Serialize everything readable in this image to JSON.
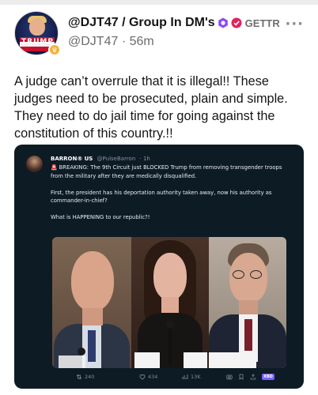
{
  "post": {
    "display_name": "@DJT47 / Group In DM's",
    "platform_label": "GETTR",
    "handle": "@DJT47",
    "separator": " · ",
    "time_ago": "56m",
    "text": "A judge can’t overrule that it is illegal!! These judges need to be prosecuted, plain and simple. They need to do jail time for going against the constitution of this country.!!",
    "more_label": "···",
    "avatar_text": "TRUMP"
  },
  "embed": {
    "author": "BARRON®",
    "flag": "US",
    "handle": "@PulseBarron",
    "time": "· 1h",
    "line1_icon": "🚨",
    "line1": "BREAKING: The 9th Circuit just BLOCKED Trump from removing transgender troops from the military after they are medically disqualified.",
    "line2": "First, the president has his deportation authority taken away, now his authority as commander-in-chief?",
    "line3": "What is HAPPENING to our republic?!",
    "actions": {
      "reposts": "240",
      "likes": "434",
      "views": "13K",
      "x_badge": "XBD"
    }
  },
  "colors": {
    "embed_bg": "#0d1b25",
    "badge_purple": "#8c4bff",
    "badge_red": "#e0245e"
  }
}
